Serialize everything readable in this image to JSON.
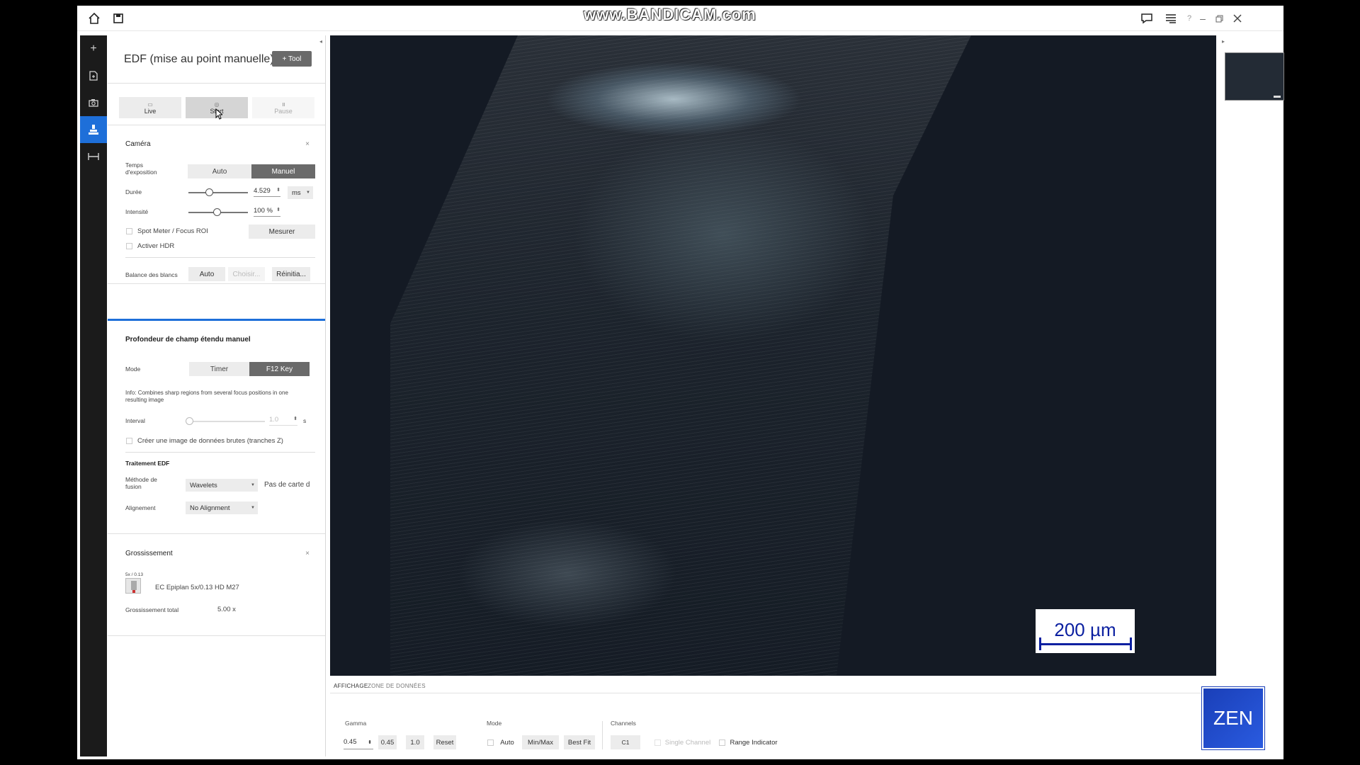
{
  "watermark": {
    "text": "www.BANDICAM.com"
  },
  "topbar": {
    "help_icon": "?"
  },
  "panel": {
    "title": "EDF (mise au point manuelle)",
    "tool_button": "+ Tool",
    "acquisition": {
      "live": "Live",
      "start": "Start",
      "pause": "Pause"
    }
  },
  "camera": {
    "title": "Caméra",
    "exposure_label": "Temps d'exposition",
    "exposure_auto": "Auto",
    "exposure_manual": "Manuel",
    "duration_label": "Durée",
    "duration_value": "4.529",
    "duration_unit": "ms",
    "duration_slider_fraction": 0.35,
    "intensity_label": "Intensité",
    "intensity_value": "100 %",
    "intensity_slider_fraction": 0.48,
    "spot_meter_label": "Spot Meter / Focus ROI",
    "measure_button": "Mesurer",
    "hdr_label": "Activer HDR",
    "white_balance_label": "Balance des blancs",
    "wb_auto": "Auto",
    "wb_choose": "Choisir...",
    "wb_reset": "Réinitia..."
  },
  "edf": {
    "title": "Profondeur de champ étendu manuel",
    "mode_label": "Mode",
    "mode_timer": "Timer",
    "mode_f12": "F12 Key",
    "info": "Info: Combines sharp regions from several focus positions in one resulting image",
    "interval_label": "Interval",
    "interval_value": "1.0",
    "interval_unit": "s",
    "raw_label": "Créer une image de données brutes (tranches Z)",
    "processing_title": "Traitement EDF",
    "fusion_label": "Méthode de fusion",
    "fusion_value": "Wavelets",
    "no_map_text": "Pas de carte d",
    "alignment_label": "Alignement",
    "alignment_value": "No Alignment"
  },
  "magnification": {
    "title": "Grossissement",
    "objective_small": "5x / 0.13",
    "objective_name": "EC Epiplan 5x/0.13 HD M27",
    "total_label": "Grossissement total",
    "total_value": "5.00 x"
  },
  "viewer": {
    "scalebar": "200 µm"
  },
  "bottom": {
    "tab_display": "AFFICHAGE",
    "tab_data": "ZONE DE DONNÉES",
    "gamma_label": "Gamma",
    "gamma_value": "0.45",
    "gamma_preset1": "0.45",
    "gamma_preset2": "1.0",
    "gamma_reset": "Reset",
    "mode_label": "Mode",
    "mode_auto": "Auto",
    "mode_minmax": "Min/Max",
    "mode_bestfit": "Best Fit",
    "channels_label": "Channels",
    "channel_c1": "C1",
    "single_channel": "Single Channel",
    "range_indicator": "Range Indicator"
  },
  "zen_logo": "ZEN",
  "colors": {
    "accent": "#1e6fd9",
    "selected": "#6a6a6a",
    "scalebar": "#0a1fa0",
    "zen": "#1a3fb8"
  }
}
